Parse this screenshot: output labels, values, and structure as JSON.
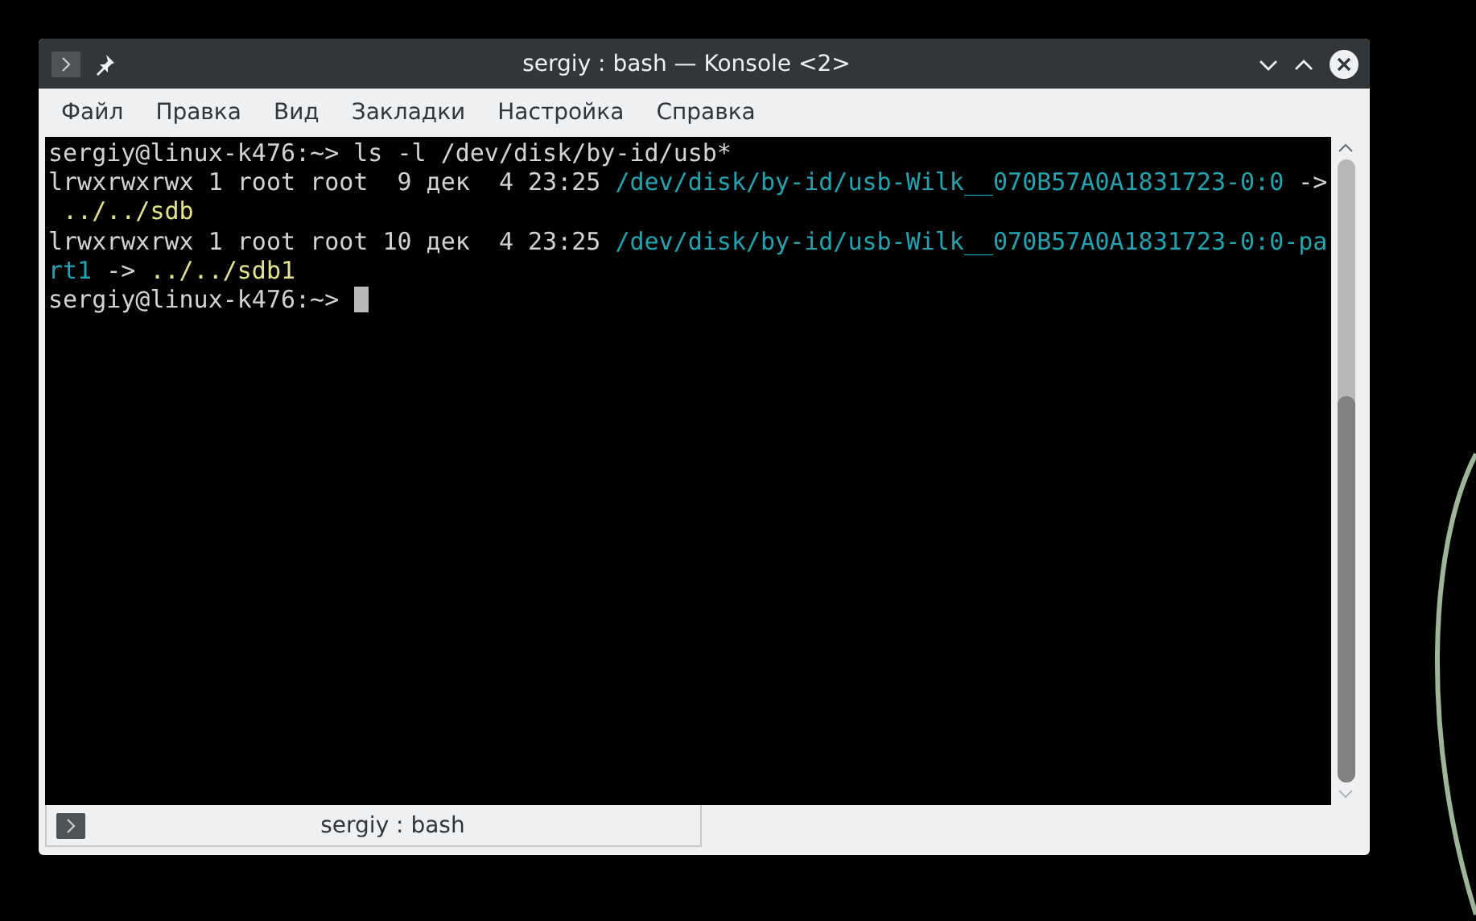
{
  "window": {
    "title": "sergiy : bash — Konsole <2>"
  },
  "menu": [
    "Файл",
    "Правка",
    "Вид",
    "Закладки",
    "Настройка",
    "Справка"
  ],
  "terminal": {
    "lines": [
      [
        {
          "kind": "plain",
          "text": "sergiy@linux-k476:~> ls -l /dev/disk/by-id/usb*"
        }
      ],
      [
        {
          "kind": "plain",
          "text": "lrwxrwxrwx 1 root root  9 дек  4 23:25 "
        },
        {
          "kind": "link",
          "text": "/dev/disk/by-id/usb-Wilk__070B57A0A1831723-0:0"
        },
        {
          "kind": "plain",
          "text": " ->"
        }
      ],
      [
        {
          "kind": "target",
          "text": " ../../sdb"
        }
      ],
      [
        {
          "kind": "plain",
          "text": "lrwxrwxrwx 1 root root 10 дек  4 23:25 "
        },
        {
          "kind": "link",
          "text": "/dev/disk/by-id/usb-Wilk__070B57A0A1831723-0:0-pa"
        }
      ],
      [
        {
          "kind": "link",
          "text": "rt1"
        },
        {
          "kind": "plain",
          "text": " -> "
        },
        {
          "kind": "target",
          "text": "../../sdb1"
        }
      ],
      [
        {
          "kind": "plain",
          "text": "sergiy@linux-k476:~> "
        },
        {
          "kind": "cursor"
        }
      ]
    ]
  },
  "tabs": [
    {
      "label": "sergiy : bash",
      "selected": true
    }
  ]
}
